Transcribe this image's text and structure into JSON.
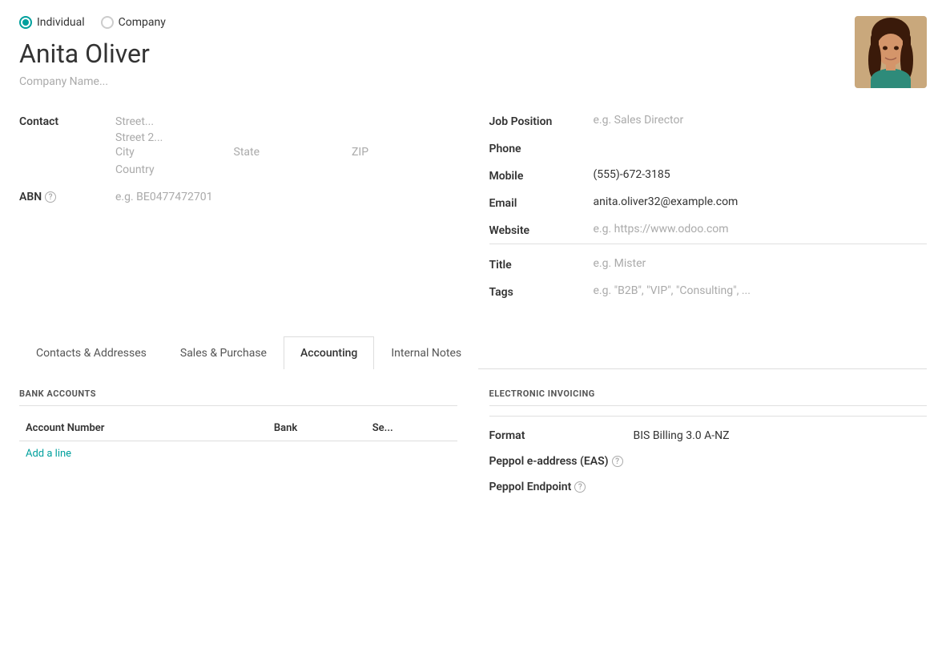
{
  "radio": {
    "individual_label": "Individual",
    "company_label": "Company",
    "selected": "individual"
  },
  "contact": {
    "name": "Anita Oliver",
    "company_placeholder": "Company Name..."
  },
  "form_left": {
    "contact_label": "Contact",
    "street_placeholder": "Street...",
    "street2_placeholder": "Street 2...",
    "city_placeholder": "City",
    "state_placeholder": "State",
    "zip_placeholder": "ZIP",
    "country_placeholder": "Country",
    "abn_label": "ABN",
    "abn_placeholder": "e.g. BE0477472701"
  },
  "form_right": {
    "job_position_label": "Job Position",
    "job_position_placeholder": "e.g. Sales Director",
    "phone_label": "Phone",
    "phone_value": "",
    "mobile_label": "Mobile",
    "mobile_value": "(555)-672-3185",
    "email_label": "Email",
    "email_value": "anita.oliver32@example.com",
    "website_label": "Website",
    "website_placeholder": "e.g. https://www.odoo.com",
    "title_label": "Title",
    "title_placeholder": "e.g. Mister",
    "tags_label": "Tags",
    "tags_placeholder": "e.g. \"B2B\", \"VIP\", \"Consulting\", ..."
  },
  "tabs": [
    {
      "id": "contacts",
      "label": "Contacts & Addresses",
      "active": false
    },
    {
      "id": "sales_purchase",
      "label": "Sales & Purchase",
      "active": false
    },
    {
      "id": "accounting",
      "label": "Accounting",
      "active": true
    },
    {
      "id": "internal_notes",
      "label": "Internal Notes",
      "active": false
    }
  ],
  "bank_accounts": {
    "section_title": "BANK ACCOUNTS",
    "col_account_number": "Account Number",
    "col_bank": "Bank",
    "col_send": "Se...",
    "add_line_label": "Add a line",
    "rows": []
  },
  "electronic_invoicing": {
    "section_title": "ELECTRONIC INVOICING",
    "format_label": "Format",
    "format_value": "BIS Billing 3.0 A-NZ",
    "peppol_eas_label": "Peppol e-address (EAS)",
    "peppol_eas_value": "",
    "peppol_endpoint_label": "Peppol Endpoint",
    "peppol_endpoint_value": ""
  }
}
